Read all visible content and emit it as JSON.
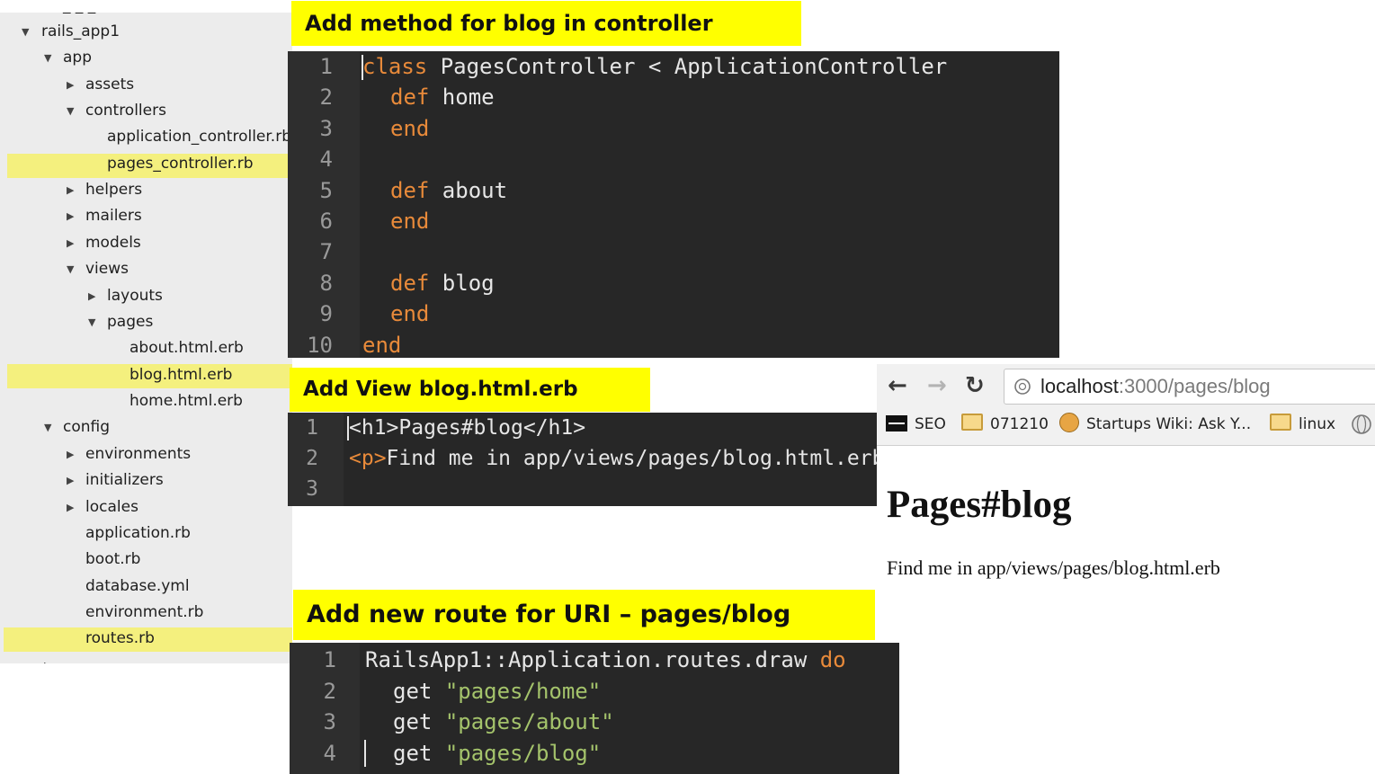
{
  "tree": {
    "items": [
      {
        "label": "rails_app1",
        "expanded": true
      },
      {
        "label": "app",
        "expanded": true
      },
      {
        "label": "assets",
        "expanded": false
      },
      {
        "label": "controllers",
        "expanded": true
      },
      {
        "label": "application_controller.rb"
      },
      {
        "label": "pages_controller.rb",
        "highlighted": true
      },
      {
        "label": "helpers",
        "expanded": false
      },
      {
        "label": "mailers",
        "expanded": false
      },
      {
        "label": "models",
        "expanded": false
      },
      {
        "label": "views",
        "expanded": true
      },
      {
        "label": "layouts",
        "expanded": false
      },
      {
        "label": "pages",
        "expanded": true
      },
      {
        "label": "about.html.erb"
      },
      {
        "label": "blog.html.erb",
        "highlighted": true
      },
      {
        "label": "home.html.erb"
      },
      {
        "label": "config",
        "expanded": true
      },
      {
        "label": "environments",
        "expanded": false
      },
      {
        "label": "initializers",
        "expanded": false
      },
      {
        "label": "locales",
        "expanded": false
      },
      {
        "label": "application.rb"
      },
      {
        "label": "boot.rb"
      },
      {
        "label": "database.yml"
      },
      {
        "label": "environment.rb"
      },
      {
        "label": "routes.rb",
        "highlighted": true
      }
    ]
  },
  "captions": {
    "controller": "Add method for blog in controller",
    "view": "Add View  blog.html.erb",
    "route": "Add new route for URI – pages/blog"
  },
  "controller_code": {
    "line_numbers": [
      "1",
      "2",
      "3",
      "4",
      "5",
      "6",
      "7",
      "8",
      "9",
      "10"
    ],
    "lines": {
      "l1": {
        "kw": "class",
        "rest": " PagesController < ApplicationController"
      },
      "l2": {
        "kw": "def",
        "rest": " home"
      },
      "l3": {
        "kw": "end"
      },
      "l5": {
        "kw": "def",
        "rest": " about"
      },
      "l6": {
        "kw": "end"
      },
      "l8": {
        "kw": "def",
        "rest": " blog"
      },
      "l9": {
        "kw": "end"
      },
      "l10": {
        "kw": "end"
      }
    }
  },
  "view_code": {
    "line_numbers": [
      "1",
      "2",
      "3"
    ],
    "line1": "<h1>Pages#blog</h1>",
    "line2": {
      "tag": "<p>",
      "text": "Find me in app/views/pages/blog.html.erb</p>"
    }
  },
  "route_code": {
    "line_numbers": [
      "1",
      "2",
      "3",
      "4"
    ],
    "line1": {
      "text": "RailsApp1::Application.routes.draw ",
      "kw": "do"
    },
    "get": "get",
    "routes": [
      "\"pages/home\"",
      "\"pages/about\"",
      "\"pages/blog\""
    ]
  },
  "browser": {
    "nav": {
      "back_icon": "arrow-left-icon",
      "forward_icon": "arrow-right-icon",
      "reload_icon": "reload-icon"
    },
    "url_host": "localhost",
    "url_rest": ":3000/pages/blog",
    "bookmarks": [
      "SEO",
      "071210",
      "Startups Wiki: Ask Y...",
      "linux"
    ],
    "page_heading": "Pages#blog",
    "page_text": "Find me in app/views/pages/blog.html.erb"
  },
  "colors": {
    "caption_bg": "#ffff00",
    "highlight": "#f4f07e",
    "editor_bg": "#272727",
    "keyword": "#e88a3a",
    "string": "#a4c36b"
  }
}
